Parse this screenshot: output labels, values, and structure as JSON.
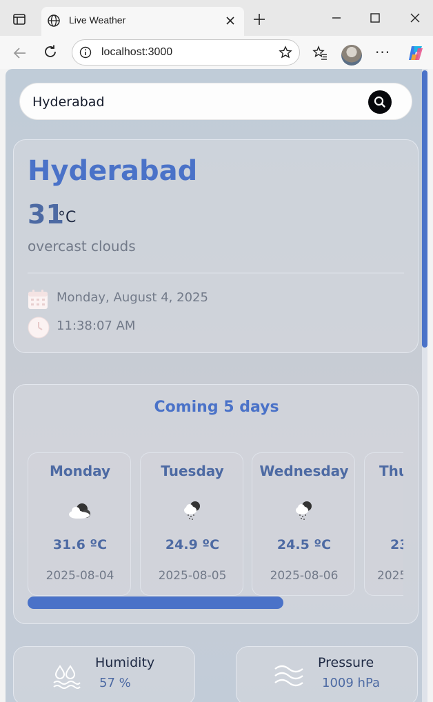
{
  "browser": {
    "tab_title": "Live Weather",
    "address": "localhost:3000",
    "more_label": "···"
  },
  "search": {
    "value": "Hyderabad"
  },
  "current": {
    "city": "Hyderabad",
    "temp": "31",
    "unit": "°C",
    "description": "overcast clouds",
    "date": "Monday, August 4, 2025",
    "time": "11:38:07 AM"
  },
  "forecast": {
    "title": "Coming 5 days",
    "days": [
      {
        "name": "Monday",
        "icon": "cloud-icon",
        "temp": "31.6 ºC",
        "date": "2025-08-04"
      },
      {
        "name": "Tuesday",
        "icon": "rain-cloud-icon",
        "temp": "24.9 ºC",
        "date": "2025-08-05"
      },
      {
        "name": "Wednesday",
        "icon": "rain-cloud-icon",
        "temp": "24.5 ºC",
        "date": "2025-08-06"
      },
      {
        "name": "Thu",
        "icon": "cloud-icon",
        "temp": "23",
        "date": "2025"
      }
    ],
    "scroll_position": 0.0,
    "scroll_visible_fraction": 0.68
  },
  "metrics": {
    "humidity": {
      "label": "Humidity",
      "value": "57 %",
      "icon": "water-drops-icon"
    },
    "pressure": {
      "label": "Pressure",
      "value": "1009 hPa",
      "icon": "wind-waves-icon"
    }
  },
  "colors": {
    "accent": "#4a72c8",
    "value_blue": "#4d6aa3",
    "muted_text": "#727a89",
    "dark_text": "#1f2a44"
  }
}
